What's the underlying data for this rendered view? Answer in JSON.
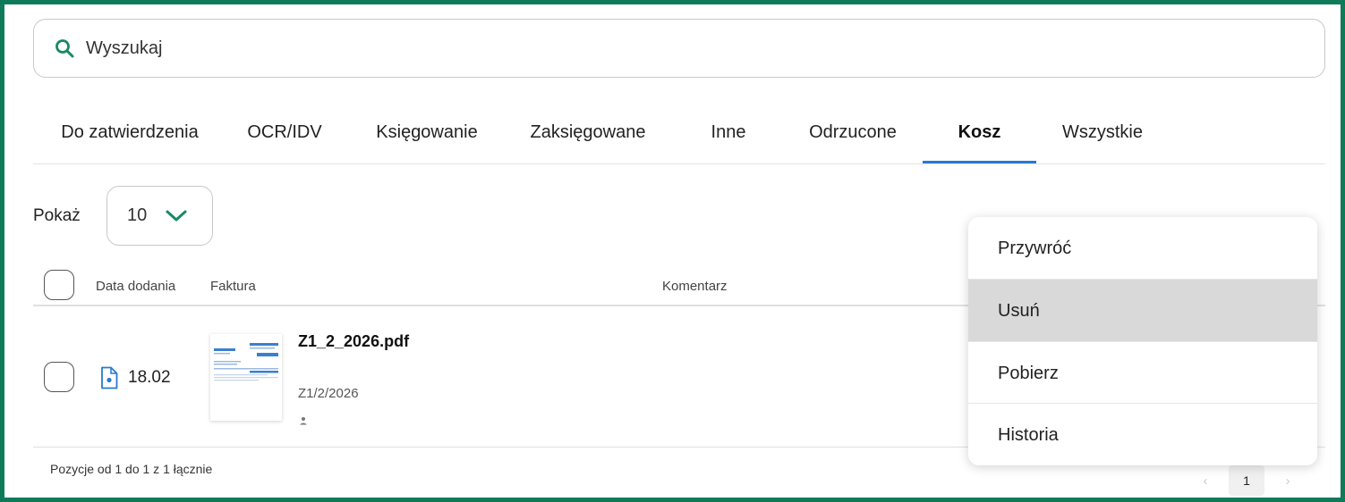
{
  "search": {
    "placeholder": "Wyszukaj"
  },
  "tabs": [
    {
      "label": "Do zatwierdzenia"
    },
    {
      "label": "OCR/IDV"
    },
    {
      "label": "Księgowanie"
    },
    {
      "label": "Zaksięgowane"
    },
    {
      "label": "Inne"
    },
    {
      "label": "Odrzucone"
    },
    {
      "label": "Kosz",
      "active": true
    },
    {
      "label": "Wszystkie"
    }
  ],
  "page_size": {
    "label": "Pokaż",
    "value": "10"
  },
  "table": {
    "headers": {
      "date": "Data dodania",
      "invoice": "Faktura",
      "comment": "Komentarz"
    },
    "rows": [
      {
        "date": "18.02",
        "filename": "Z1_2_2026.pdf",
        "number": "Z1/2/2026"
      }
    ]
  },
  "footer": {
    "summary": "Pozycje od 1 do 1 z 1 łącznie"
  },
  "pagination": {
    "prev": "‹",
    "current": "1",
    "next": "›"
  },
  "context_menu": {
    "items": [
      {
        "label": "Przywróć"
      },
      {
        "label": "Usuń",
        "hovered": true
      },
      {
        "label": "Pobierz"
      },
      {
        "label": "Historia"
      }
    ]
  },
  "colors": {
    "frame": "#0f7a5a",
    "accent_green": "#1a8a63",
    "tab_underline": "#2979d0",
    "file_icon": "#2979d0",
    "menu_hover": "#d9d9d9"
  }
}
